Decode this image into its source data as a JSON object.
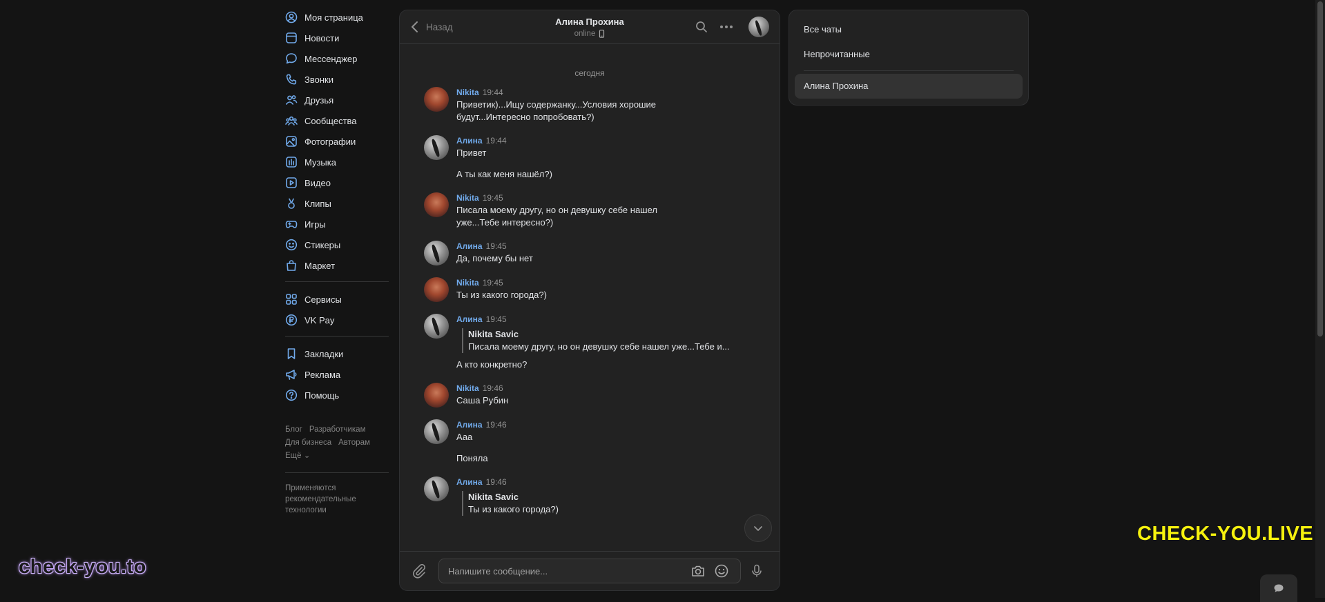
{
  "nav": {
    "items": [
      {
        "label": "Моя страница",
        "icon": "user-circle-icon"
      },
      {
        "label": "Новости",
        "icon": "news-icon"
      },
      {
        "label": "Мессенджер",
        "icon": "message-icon"
      },
      {
        "label": "Звонки",
        "icon": "phone-icon"
      },
      {
        "label": "Друзья",
        "icon": "friends-icon"
      },
      {
        "label": "Сообщества",
        "icon": "communities-icon"
      },
      {
        "label": "Фотографии",
        "icon": "photo-icon"
      },
      {
        "label": "Музыка",
        "icon": "music-icon"
      },
      {
        "label": "Видео",
        "icon": "video-icon"
      },
      {
        "label": "Клипы",
        "icon": "clips-icon"
      },
      {
        "label": "Игры",
        "icon": "gamepad-icon"
      },
      {
        "label": "Стикеры",
        "icon": "smile-icon"
      },
      {
        "label": "Маркет",
        "icon": "bag-icon"
      }
    ],
    "group2": [
      {
        "label": "Сервисы",
        "icon": "services-icon"
      },
      {
        "label": "VK Pay",
        "icon": "ruble-icon"
      }
    ],
    "group3": [
      {
        "label": "Закладки",
        "icon": "bookmark-icon"
      },
      {
        "label": "Реклама",
        "icon": "megaphone-icon"
      },
      {
        "label": "Помощь",
        "icon": "help-icon"
      }
    ],
    "footer": {
      "blog": "Блог",
      "developers": "Разработчикам",
      "business": "Для бизнеса",
      "authors": "Авторам",
      "more": "Ещё ⌄",
      "note": "Применяются рекомендательные технологии"
    }
  },
  "chat": {
    "back_label": "Назад",
    "title": "Алина Прохина",
    "status": "online",
    "day_separator": "сегодня",
    "messages": [
      {
        "author": "Nikita",
        "time": "19:44",
        "avatar": "nikita",
        "lines": [
          "Приветик)...Ищу содержанку...Условия хорошие будут...Интересно попробовать?)"
        ]
      },
      {
        "author": "Алина",
        "time": "19:44",
        "avatar": "alina",
        "lines": [
          "Привет",
          "А ты как меня нашёл?)"
        ]
      },
      {
        "author": "Nikita",
        "time": "19:45",
        "avatar": "nikita",
        "lines": [
          "Писала моему другу, но он девушку себе нашел уже...Тебе интересно?)"
        ]
      },
      {
        "author": "Алина",
        "time": "19:45",
        "avatar": "alina",
        "lines": [
          "Да, почему бы нет"
        ]
      },
      {
        "author": "Nikita",
        "time": "19:45",
        "avatar": "nikita",
        "lines": [
          "Ты из какого города?)"
        ]
      },
      {
        "author": "Алина",
        "time": "19:45",
        "avatar": "alina",
        "quote": {
          "author": "Nikita Savic",
          "text": "Писала моему другу, но он девушку себе нашел уже...Тебе и..."
        },
        "lines": [
          "А кто конкретно?"
        ]
      },
      {
        "author": "Nikita",
        "time": "19:46",
        "avatar": "nikita",
        "lines": [
          "Саша Рубин"
        ]
      },
      {
        "author": "Алина",
        "time": "19:46",
        "avatar": "alina",
        "lines": [
          "Ааа",
          "Поняла"
        ]
      },
      {
        "author": "Алина",
        "time": "19:46",
        "avatar": "alina",
        "quote": {
          "author": "Nikita Savic",
          "text": "Ты из какого города?)"
        },
        "lines": []
      }
    ],
    "composer": {
      "placeholder": "Напишите сообщение..."
    }
  },
  "filters": {
    "all": "Все чаты",
    "unread": "Непрочитанные",
    "current": "Алина Прохина"
  },
  "watermarks": {
    "left": "check-you.to",
    "right": "CHECK-YOU.LIVE"
  },
  "colors": {
    "background": "#141414",
    "panel": "#222222",
    "accent_link": "#71aaeb",
    "watermark_yellow": "#f6f20e"
  }
}
